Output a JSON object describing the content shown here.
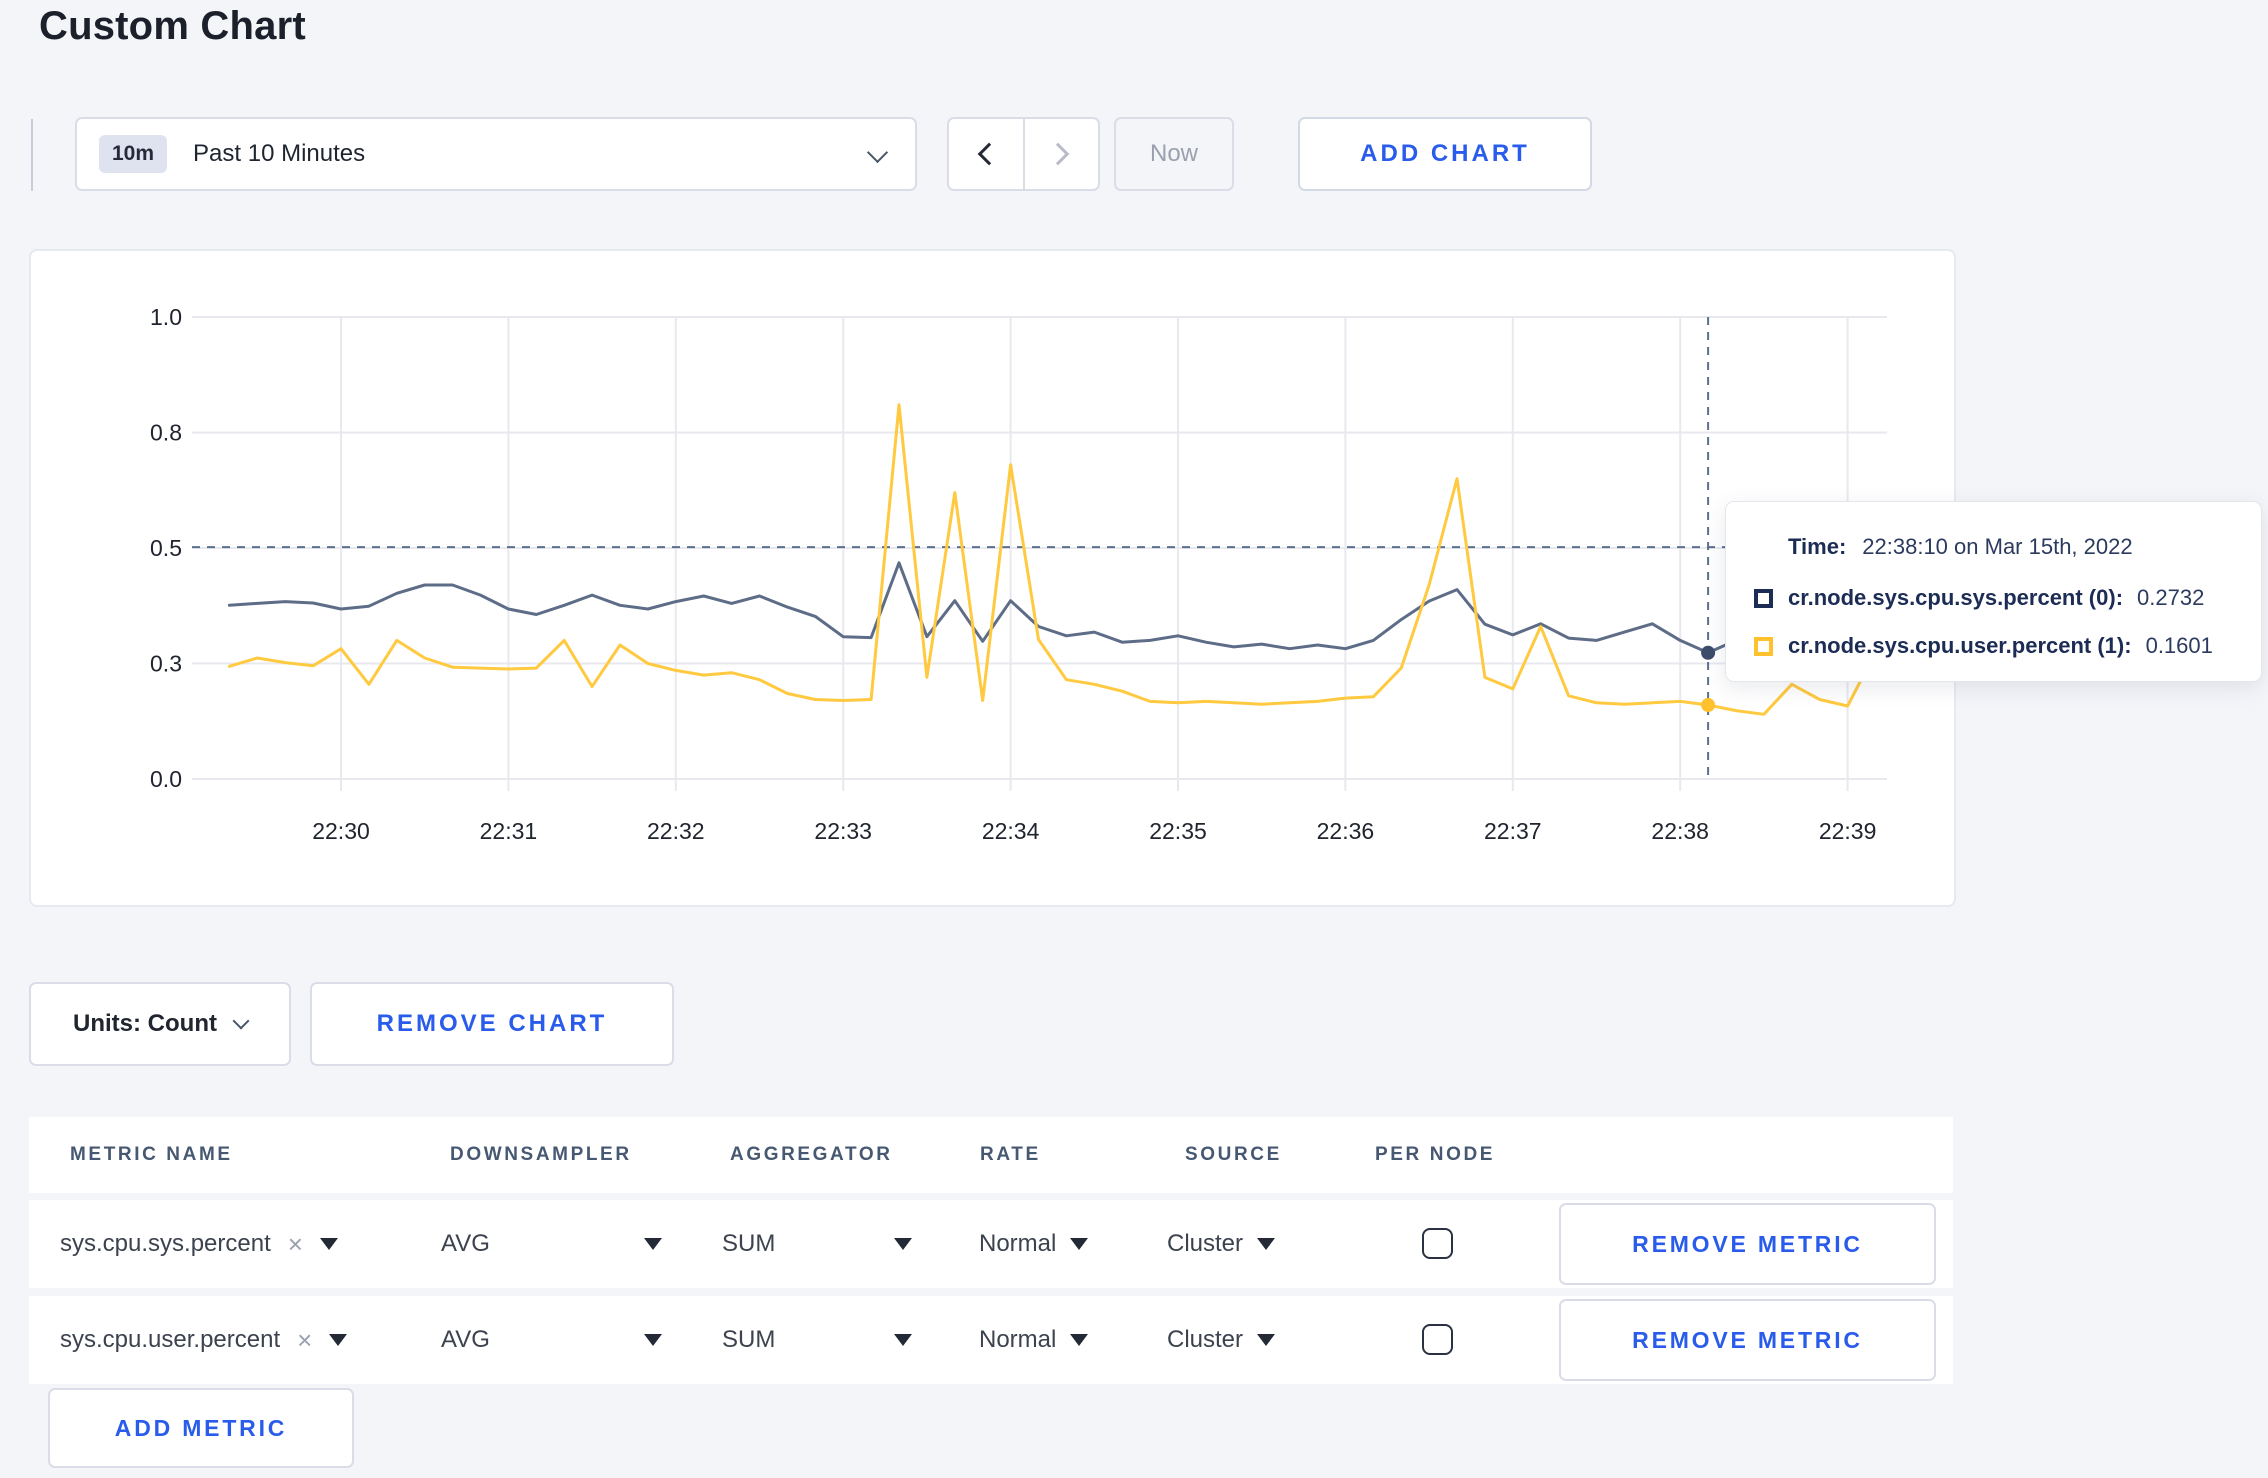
{
  "page_title": "Custom Chart",
  "controls": {
    "range_badge": "10m",
    "range_label": "Past 10 Minutes",
    "now_label": "Now",
    "add_chart_label": "ADD CHART"
  },
  "chart_toolbar": {
    "units_label": "Units: Count",
    "remove_chart_label": "REMOVE CHART"
  },
  "tooltip": {
    "time_label": "Time:",
    "time_value": "22:38:10 on Mar 15th, 2022",
    "rows": [
      {
        "name": "cr.node.sys.cpu.sys.percent (0):",
        "value": "0.2732",
        "color": "#1c2c55"
      },
      {
        "name": "cr.node.sys.cpu.user.percent (1):",
        "value": "0.1601",
        "color": "#ffc12e"
      }
    ]
  },
  "chart_data": {
    "type": "line",
    "x_ticks": [
      "22:30",
      "22:31",
      "22:32",
      "22:33",
      "22:34",
      "22:35",
      "22:36",
      "22:37",
      "22:38",
      "22:39"
    ],
    "y_ticks": [
      {
        "label": "0.0",
        "value": 0
      },
      {
        "label": "0.3",
        "value": 0.25
      },
      {
        "label": "0.5",
        "value": 0.5
      },
      {
        "label": "0.8",
        "value": 0.75
      },
      {
        "label": "1.0",
        "value": 1.0
      }
    ],
    "ylim": [
      0,
      1
    ],
    "grid": true,
    "start_time": "22:29:20",
    "interval_seconds": 10,
    "hover": {
      "index": 53,
      "time": "22:38:10",
      "guide_value": 0.502
    },
    "series": [
      {
        "name": "cr.node.sys.cpu.sys.percent (0)",
        "color": "#5d6c87",
        "dot_color": "#3c4c6b",
        "hover_value": 0.2732,
        "values": [
          0.376,
          0.38,
          0.384,
          0.381,
          0.368,
          0.374,
          0.402,
          0.42,
          0.42,
          0.398,
          0.368,
          0.356,
          0.376,
          0.398,
          0.376,
          0.368,
          0.384,
          0.396,
          0.38,
          0.396,
          0.372,
          0.352,
          0.308,
          0.306,
          0.468,
          0.308,
          0.386,
          0.298,
          0.386,
          0.33,
          0.31,
          0.318,
          0.296,
          0.3,
          0.31,
          0.296,
          0.286,
          0.292,
          0.282,
          0.29,
          0.282,
          0.3,
          0.345,
          0.385,
          0.41,
          0.335,
          0.312,
          0.336,
          0.305,
          0.3,
          0.318,
          0.336,
          0.3,
          0.2732,
          0.3,
          0.296,
          0.29,
          0.296,
          0.288,
          0.292,
          0.285
        ]
      },
      {
        "name": "cr.node.sys.cpu.user.percent (1)",
        "color": "#ffc940",
        "dot_color": "#ffc12e",
        "hover_value": 0.1601,
        "values": [
          0.244,
          0.262,
          0.252,
          0.245,
          0.282,
          0.205,
          0.3,
          0.262,
          0.242,
          0.24,
          0.238,
          0.24,
          0.3,
          0.2,
          0.29,
          0.25,
          0.235,
          0.225,
          0.23,
          0.215,
          0.185,
          0.172,
          0.17,
          0.172,
          0.81,
          0.22,
          0.62,
          0.17,
          0.68,
          0.302,
          0.215,
          0.205,
          0.19,
          0.168,
          0.165,
          0.168,
          0.165,
          0.162,
          0.165,
          0.168,
          0.175,
          0.178,
          0.24,
          0.42,
          0.65,
          0.22,
          0.195,
          0.33,
          0.18,
          0.165,
          0.162,
          0.165,
          0.168,
          0.1601,
          0.148,
          0.14,
          0.205,
          0.172,
          0.158,
          0.275,
          0.215
        ]
      }
    ]
  },
  "table": {
    "headers": [
      "METRIC NAME",
      "DOWNSAMPLER",
      "AGGREGATOR",
      "RATE",
      "SOURCE",
      "PER NODE"
    ],
    "rows": [
      {
        "metric": "sys.cpu.sys.percent",
        "remove_symbol": "×",
        "downsampler": "AVG",
        "aggregator": "SUM",
        "rate": "Normal",
        "source": "Cluster",
        "per_node_checked": false,
        "remove_label": "REMOVE METRIC"
      },
      {
        "metric": "sys.cpu.user.percent",
        "remove_symbol": "×",
        "downsampler": "AVG",
        "aggregator": "SUM",
        "rate": "Normal",
        "source": "Cluster",
        "per_node_checked": false,
        "remove_label": "REMOVE METRIC"
      }
    ],
    "add_metric_label": "ADD METRIC"
  },
  "colors": {
    "accent_blue": "#2a5ceb",
    "page_bg": "#f4f5f9",
    "grid_line": "#e8e9ee",
    "axis_text": "#20242e",
    "crosshair": "#5b708f"
  }
}
